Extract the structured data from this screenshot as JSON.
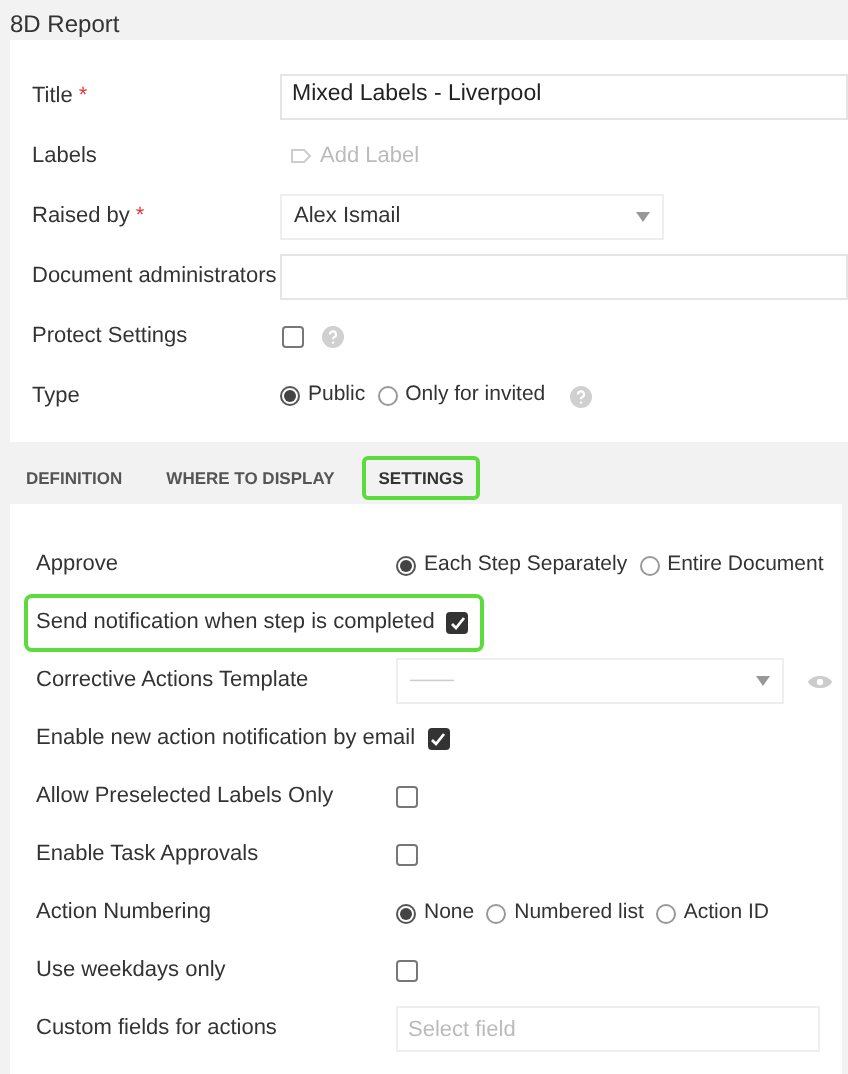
{
  "header": {
    "title": "8D Report"
  },
  "fields": [
    {
      "kind": "text",
      "label": "Title",
      "required_mark": "*",
      "value": "Mixed Labels - Liverpool"
    },
    {
      "kind": "labels",
      "label": "Labels",
      "placeholder": "Add Label"
    },
    {
      "kind": "select",
      "label": "Raised by",
      "required_mark": "*",
      "value": "Alex Ismail"
    },
    {
      "kind": "text",
      "label": "Document administrators"
    },
    {
      "kind": "checkbox",
      "label": "Protect Settings",
      "checked": false,
      "help": true
    },
    {
      "kind": "radio",
      "label": "Type",
      "help": true,
      "options": [
        {
          "label": "Public",
          "selected": true
        },
        {
          "label": "Only for invited",
          "selected": false
        }
      ]
    }
  ],
  "tabs": [
    {
      "label": "DEFINITION",
      "selected": false,
      "highlighted": false
    },
    {
      "label": "WHERE TO DISPLAY",
      "selected": false,
      "highlighted": false
    },
    {
      "label": "SETTINGS",
      "selected": true,
      "highlighted": true
    }
  ],
  "settings": [
    {
      "kind": "radio",
      "label": "Approve",
      "highlighted": false,
      "options": [
        {
          "label": "Each Step Separately",
          "selected": true
        },
        {
          "label": "Entire Document",
          "selected": false
        }
      ]
    },
    {
      "kind": "checkbox",
      "label": "Send notification when step is completed",
      "highlighted": true,
      "checked": true
    },
    {
      "kind": "select",
      "label": "Corrective Actions Template",
      "highlighted": false,
      "placeholder": "——"
    },
    {
      "kind": "checkbox",
      "label": "Enable new action notification by email",
      "highlighted": false,
      "checked": true
    },
    {
      "kind": "checkbox",
      "label": "Allow Preselected Labels Only",
      "highlighted": false,
      "checked": false
    },
    {
      "kind": "checkbox",
      "label": "Enable Task Approvals",
      "highlighted": false,
      "checked": false
    },
    {
      "kind": "radio",
      "label": "Action Numbering",
      "highlighted": false,
      "options": [
        {
          "label": "None",
          "selected": true
        },
        {
          "label": "Numbered list",
          "selected": false
        },
        {
          "label": "Action ID",
          "selected": false
        }
      ]
    },
    {
      "kind": "checkbox",
      "label": "Use weekdays only",
      "highlighted": false,
      "checked": false
    },
    {
      "kind": "field",
      "label": "Custom fields for actions",
      "highlighted": false,
      "placeholder": "Select field"
    }
  ]
}
